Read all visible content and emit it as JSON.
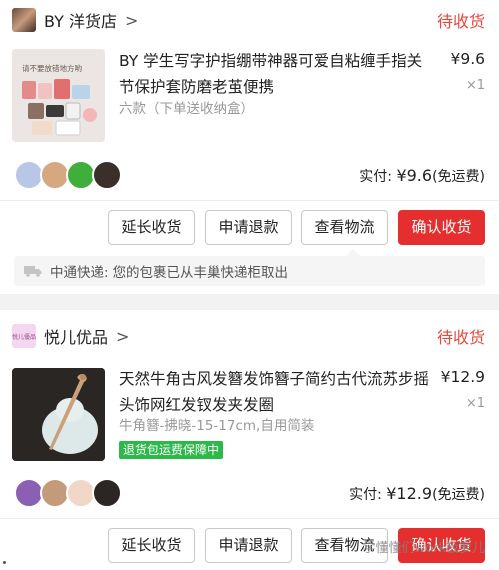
{
  "orders": [
    {
      "shop_name": "BY 洋货店",
      "status": "待收货",
      "product": {
        "title": "BY 学生写字护指绷带神器可爱自粘缠手指关节保护套防磨老茧便携",
        "sku": "六款（下单送收纳盒）",
        "price": "¥9.6",
        "qty": "×1",
        "image_caption": "请不要放错地方哟"
      },
      "paid_label": "实付: ",
      "paid_amount": "¥9.6",
      "shipping_note": "(免运费)",
      "buttons": {
        "extend": "延长收货",
        "refund": "申请退款",
        "logistics": "查看物流",
        "confirm": "确认收货"
      },
      "logistics": {
        "carrier": "中通快递:",
        "message": "您的包裹已从丰巢快递柜取出"
      }
    },
    {
      "shop_name": "悦儿优品",
      "shop_logo_text": "悦儿優品",
      "status": "待收货",
      "product": {
        "title": "天然牛角古风发簪发饰簪子简约古代流苏步摇头饰网红发钗发夹发圈",
        "sku": "牛角簪-拂晓-15-17cm,自用简装",
        "price": "¥12.9",
        "qty": "×1",
        "guarantee": "退货包运费保障中"
      },
      "paid_label": "实付: ",
      "paid_amount": "¥12.9",
      "shipping_note": "(免运费)",
      "buttons": {
        "extend": "延长收货",
        "refund": "申请退款",
        "logistics": "查看物流",
        "confirm": "确认收货"
      }
    }
  ],
  "watermark": "学懂懂们work板箩儿",
  "colors": {
    "accent_red": "#e52e2e",
    "status_red": "#e8473f",
    "guarantee_green": "#2db84a"
  },
  "icons": {
    "shop_arrow": "chevron-right-icon",
    "truck": "truck-icon"
  }
}
